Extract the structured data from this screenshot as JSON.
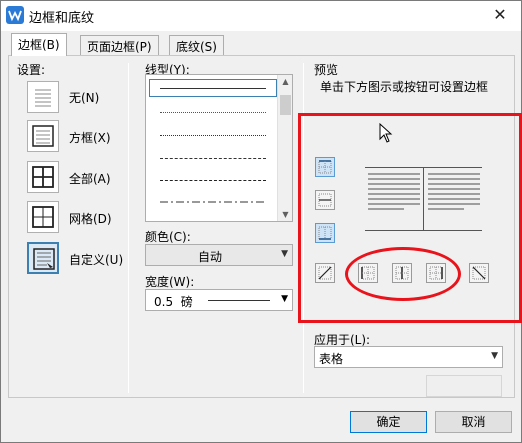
{
  "window": {
    "title": "边框和底纹",
    "close_glyph": "✕"
  },
  "tabs": [
    {
      "label": "边框(B)",
      "active": true
    },
    {
      "label": "页面边框(P)",
      "active": false
    },
    {
      "label": "底纹(S)",
      "active": false
    }
  ],
  "settings": {
    "heading": "设置:",
    "items": [
      {
        "label": "无(N)",
        "icon": "none-border-icon",
        "selected": false
      },
      {
        "label": "方框(X)",
        "icon": "box-border-icon",
        "selected": false
      },
      {
        "label": "全部(A)",
        "icon": "all-borders-icon",
        "selected": false
      },
      {
        "label": "网格(D)",
        "icon": "grid-border-icon",
        "selected": false
      },
      {
        "label": "自定义(U)",
        "icon": "custom-border-icon",
        "selected": true
      }
    ]
  },
  "line_style": {
    "heading": "线型(Y):",
    "styles": [
      "solid",
      "dotted-fine",
      "dotted",
      "dashed-short",
      "dashed",
      "dash-dot",
      "dash-dot-long"
    ]
  },
  "color": {
    "label": "颜色(C):",
    "value": "自动"
  },
  "width": {
    "label": "宽度(W):",
    "value": "0.5  磅"
  },
  "preview": {
    "heading": "预览",
    "hint": "单击下方图示或按钮可设置边框"
  },
  "apply_to": {
    "label": "应用于(L):",
    "value": "表格"
  },
  "buttons": {
    "ok": "确定",
    "cancel": "取消"
  },
  "colors": {
    "accent": "#3c7fb1",
    "annotation": "#e8131b",
    "app_icon": "#2b7bd6"
  }
}
